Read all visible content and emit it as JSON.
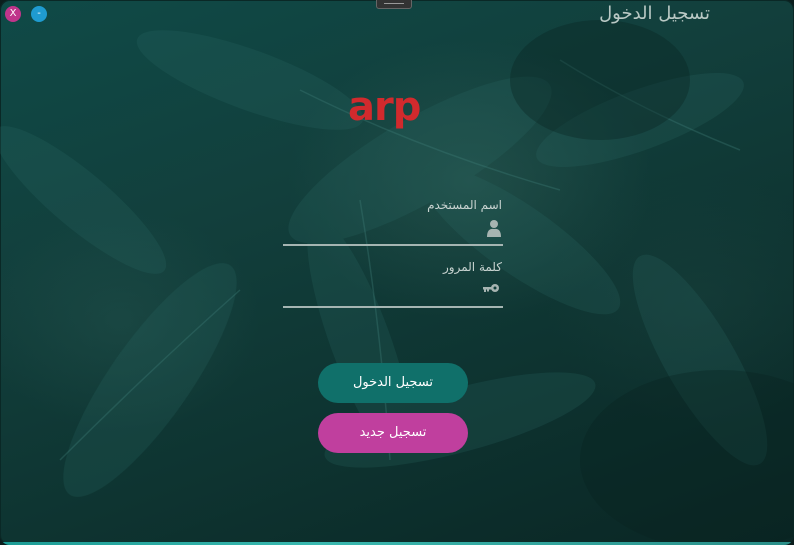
{
  "window": {
    "title": "تسجيل الدخول",
    "close_label": "X",
    "minimize_label": "-"
  },
  "logo": {
    "text": "arp",
    "color": "#d12a2d"
  },
  "form": {
    "username": {
      "label": "اسم المستخدم",
      "value": "",
      "placeholder": "",
      "icon": "user-icon"
    },
    "password": {
      "label": "كلمة المرور",
      "value": "",
      "placeholder": "",
      "icon": "key-icon"
    }
  },
  "buttons": {
    "login_label": "تسجيل الدخول",
    "signup_label": "تسجيل جديد"
  },
  "colors": {
    "close": "#c0358b",
    "minimize": "#1f9bd0",
    "login_button": "#10706a",
    "signup_button": "#c03f9e"
  }
}
